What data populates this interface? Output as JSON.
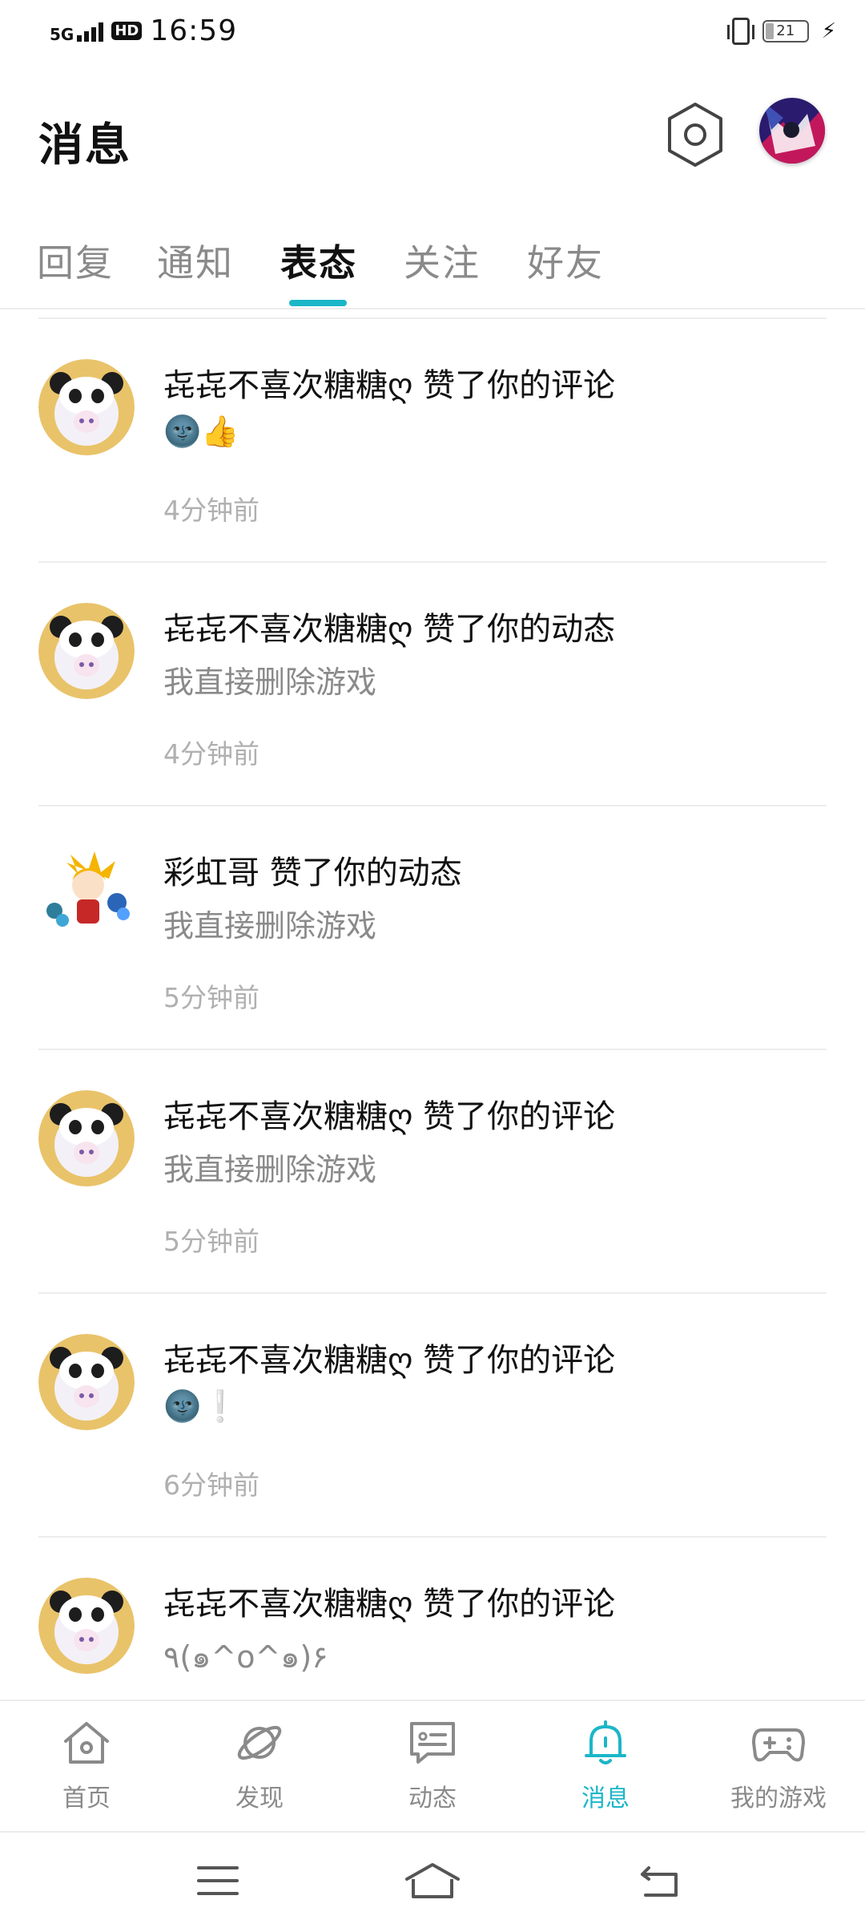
{
  "status_bar": {
    "network": "5G",
    "hd": "HD",
    "time": "16:59",
    "battery": "21"
  },
  "header": {
    "title": "消息"
  },
  "tabs": [
    {
      "label": "回复"
    },
    {
      "label": "通知"
    },
    {
      "label": "表态"
    },
    {
      "label": "关注"
    },
    {
      "label": "好友"
    }
  ],
  "active_tab": "表态",
  "notifications": [
    {
      "line1": "㐂㐂不喜次糖糖ღ 赞了你的评论",
      "line2": "🌚👍",
      "time": "4分钟前",
      "avatar": "panda-avatar"
    },
    {
      "line1": "㐂㐂不喜次糖糖ღ 赞了你的动态",
      "line2": "我直接删除游戏",
      "time": "4分钟前",
      "avatar": "panda-avatar"
    },
    {
      "line1": "彩虹哥 赞了你的动态",
      "line2": "我直接删除游戏",
      "time": "5分钟前",
      "avatar": "anime-avatar"
    },
    {
      "line1": "㐂㐂不喜次糖糖ღ 赞了你的评论",
      "line2": "我直接删除游戏",
      "time": "5分钟前",
      "avatar": "panda-avatar"
    },
    {
      "line1": "㐂㐂不喜次糖糖ღ 赞了你的评论",
      "line2": "🌚❕",
      "time": "6分钟前",
      "avatar": "panda-avatar"
    },
    {
      "line1": "㐂㐂不喜次糖糖ღ 赞了你的评论",
      "line2": "٩(๑^o^๑)۶",
      "time": "",
      "avatar": "panda-avatar"
    }
  ],
  "bottom_nav": [
    {
      "label": "首页",
      "icon": "home-icon"
    },
    {
      "label": "发现",
      "icon": "planet-icon"
    },
    {
      "label": "动态",
      "icon": "chat-card-icon"
    },
    {
      "label": "消息",
      "icon": "bell-icon"
    },
    {
      "label": "我的游戏",
      "icon": "gamepad-icon"
    }
  ],
  "colors": {
    "accent": "#1bb6c8",
    "text": "#111111",
    "secondary": "#8a8a8a",
    "time": "#b0b0b0"
  }
}
